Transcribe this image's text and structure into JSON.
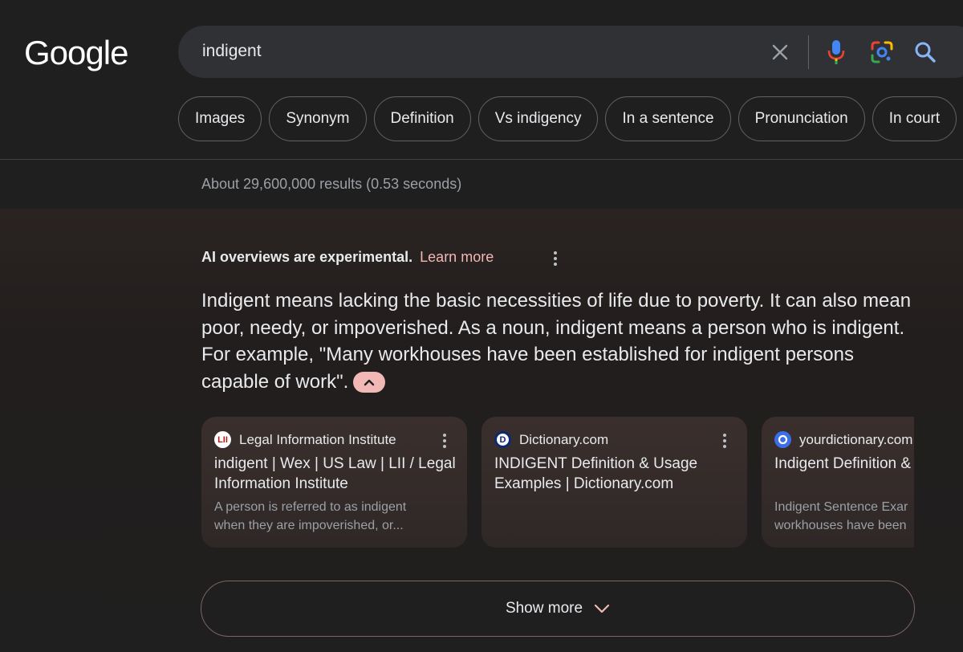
{
  "logo": "Google",
  "search": {
    "query": "indigent"
  },
  "chips": [
    "Images",
    "Synonym",
    "Definition",
    "Vs indigency",
    "In a sentence",
    "Pronunciation",
    "In court"
  ],
  "result_stats": "About 29,600,000 results (0.53 seconds)",
  "ai_overview": {
    "header": "AI overviews are experimental.",
    "learn_more": "Learn more",
    "text": "Indigent means lacking the basic necessities of life due to poverty. It can also mean poor, needy, or impoverished. As a noun, indigent means a person who is indigent. For example, \"Many workhouses have been established for indigent persons capable of work\".",
    "cards": [
      {
        "source": "Legal Information Institute",
        "title": "indigent | Wex | US Law | LII / Legal Information Institute",
        "snippet_lines": [
          "A person is referred to as indigent",
          "when they are impoverished, or..."
        ]
      },
      {
        "source": "Dictionary.com",
        "title": "INDIGENT Definition & Usage Examples | Dictionary.com",
        "snippet_lines": [
          "",
          ""
        ]
      },
      {
        "source": "yourdictionary.com",
        "title": "Indigent Definition & YourDictionary",
        "snippet_lines": [
          "Indigent Sentence Exar",
          "workhouses have been"
        ]
      }
    ],
    "show_more": "Show more"
  },
  "colors": {
    "accent": "#f2b8b5",
    "background": "#1f1f1f",
    "searchbar": "#303134"
  }
}
